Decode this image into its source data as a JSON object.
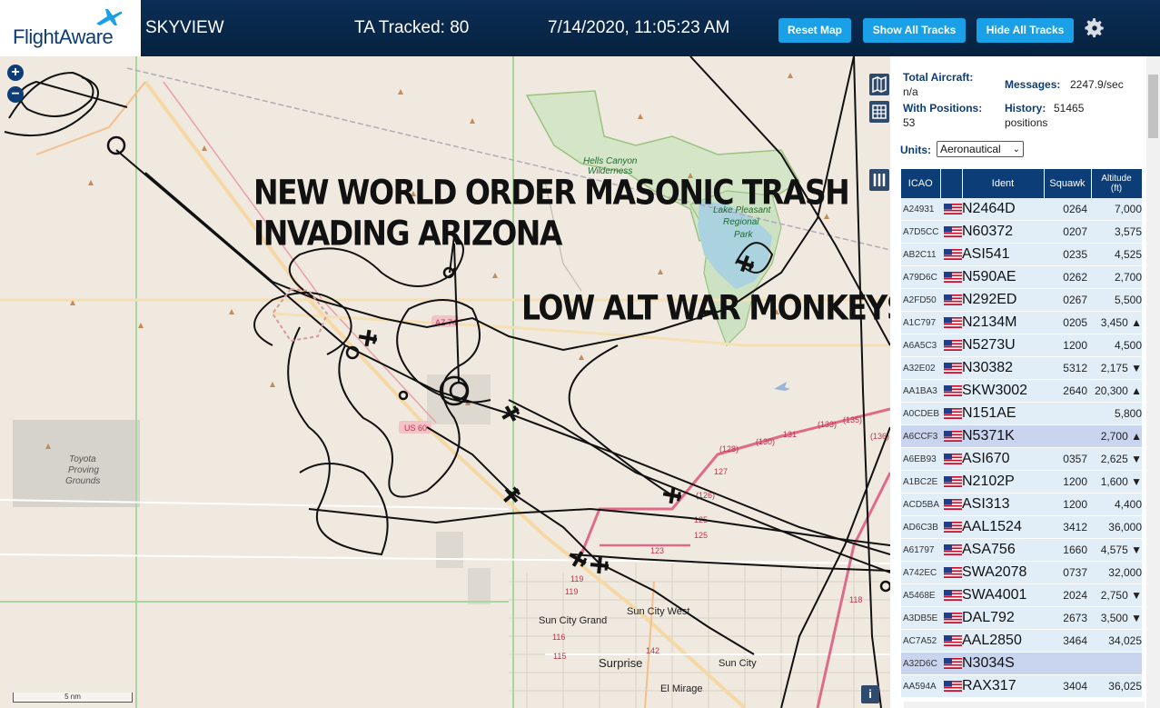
{
  "header": {
    "logo_text": "FlightAware",
    "app_name": "SKYVIEW",
    "tracked": "TA Tracked: 80",
    "datetime": "7/14/2020, 11:05:23 AM",
    "buttons": {
      "reset_map": "Reset Map",
      "show_all": "Show All Tracks",
      "hide_all": "Hide All Tracks"
    },
    "settings_icon": "gear-icon"
  },
  "map": {
    "overlay_text_1": "NEW WORLD ORDER MASONIC TRASH",
    "overlay_text_2": "INVADING ARIZONA",
    "overlay_text_3": "LOW ALT WAR MONKEYS",
    "zoom_in": "+",
    "zoom_out": "−",
    "labels": {
      "hells_canyon": "Hells Canyon",
      "wilderness": "Wilderness",
      "lake_pleasant_1": "Lake Pleasant",
      "lake_pleasant_2": "Regional",
      "lake_pleasant_3": "Park",
      "toyota_1": "Toyota",
      "toyota_2": "Proving",
      "toyota_3": "Grounds",
      "sun_city_grand": "Sun City Grand",
      "sun_city_west": "Sun City West",
      "surprise": "Surprise",
      "sun_city": "Sun City",
      "el_mirage": "El Mirage",
      "us60": "US 60",
      "az74": "AZ 74",
      "r128": "(128)",
      "r130": "(130)",
      "r131": "131",
      "r133": "(133)",
      "r135": "(135)",
      "r136": "(136)",
      "r127": "127",
      "r126": "(126)",
      "r125a": "125",
      "r125b": "125",
      "r123": "123",
      "r119a": "119",
      "r119b": "119",
      "r116": "116",
      "r115": "115",
      "r142": "142",
      "r118": "118"
    },
    "scale": "5 nm",
    "info": "i",
    "tool_icons": [
      "map-layers-icon",
      "grid-icon",
      "columns-icon"
    ]
  },
  "stats": {
    "total_label": "Total Aircraft:",
    "total_value": "n/a",
    "messages_label": "Messages:",
    "messages_value": "2247.9/sec",
    "positions_label": "With Positions:",
    "positions_value": "53",
    "history_label": "History:",
    "history_value": "51465",
    "history_unit": "positions",
    "units_label": "Units:",
    "units_value": "Aeronautical"
  },
  "table": {
    "headers": {
      "icao": "ICAO",
      "ident": "Ident",
      "squawk": "Squawk",
      "alt1": "Altitude",
      "alt2": "(ft)"
    },
    "rows": [
      {
        "icao": "A24931",
        "ident": "N2464D",
        "squawk": "0264",
        "alt": "7,000",
        "hl": false
      },
      {
        "icao": "A7D5CC",
        "ident": "N60372",
        "squawk": "0207",
        "alt": "3,575",
        "hl": false
      },
      {
        "icao": "AB2C11",
        "ident": "ASI541",
        "squawk": "0235",
        "alt": "4,525",
        "hl": false
      },
      {
        "icao": "A79D6C",
        "ident": "N590AE",
        "squawk": "0262",
        "alt": "2,700",
        "hl": false
      },
      {
        "icao": "A2FD50",
        "ident": "N292ED",
        "squawk": "0267",
        "alt": "5,500",
        "hl": false
      },
      {
        "icao": "A1C797",
        "ident": "N2134M",
        "squawk": "0205",
        "alt": "3,450 ▲",
        "hl": false
      },
      {
        "icao": "A6A5C3",
        "ident": "N5273U",
        "squawk": "1200",
        "alt": "4,500",
        "hl": false
      },
      {
        "icao": "A32E02",
        "ident": "N30382",
        "squawk": "5312",
        "alt": "2,175 ▼",
        "hl": false
      },
      {
        "icao": "AA1BA3",
        "ident": "SKW3002",
        "squawk": "2640",
        "alt": "20,300 ▲",
        "hl": false
      },
      {
        "icao": "A0CDEB",
        "ident": "N151AE",
        "squawk": "",
        "alt": "5,800",
        "hl": false
      },
      {
        "icao": "A6CCF3",
        "ident": "N5371K",
        "squawk": "",
        "alt": "2,700 ▲",
        "hl": true
      },
      {
        "icao": "A6EB93",
        "ident": "ASI670",
        "squawk": "0357",
        "alt": "2,625 ▼",
        "hl": false
      },
      {
        "icao": "A1BC2E",
        "ident": "N2102P",
        "squawk": "1200",
        "alt": "1,600 ▼",
        "hl": false
      },
      {
        "icao": "ACD5BA",
        "ident": "ASI313",
        "squawk": "1200",
        "alt": "4,400",
        "hl": false
      },
      {
        "icao": "AD6C3B",
        "ident": "AAL1524",
        "squawk": "3412",
        "alt": "36,000",
        "hl": false
      },
      {
        "icao": "A61797",
        "ident": "ASA756",
        "squawk": "1660",
        "alt": "4,575 ▼",
        "hl": false
      },
      {
        "icao": "A742EC",
        "ident": "SWA2078",
        "squawk": "0737",
        "alt": "32,000",
        "hl": false
      },
      {
        "icao": "A5468E",
        "ident": "SWA4001",
        "squawk": "2024",
        "alt": "2,750 ▼",
        "hl": false
      },
      {
        "icao": "A3DB5E",
        "ident": "DAL792",
        "squawk": "2673",
        "alt": "3,500 ▼",
        "hl": false
      },
      {
        "icao": "AC7A52",
        "ident": "AAL2850",
        "squawk": "3464",
        "alt": "34,025",
        "hl": false
      },
      {
        "icao": "A32D6C",
        "ident": "N3034S",
        "squawk": "",
        "alt": "",
        "hl": true
      },
      {
        "icao": "AA594A",
        "ident": "RAX317",
        "squawk": "3404",
        "alt": "36,025",
        "hl": false
      }
    ]
  },
  "colors": {
    "header_bg": "#06223f",
    "button": "#1aa0e6",
    "table_header": "#0c3d76",
    "row_alt": "#e1eef8",
    "row_highlight": "#c9d4ee"
  }
}
